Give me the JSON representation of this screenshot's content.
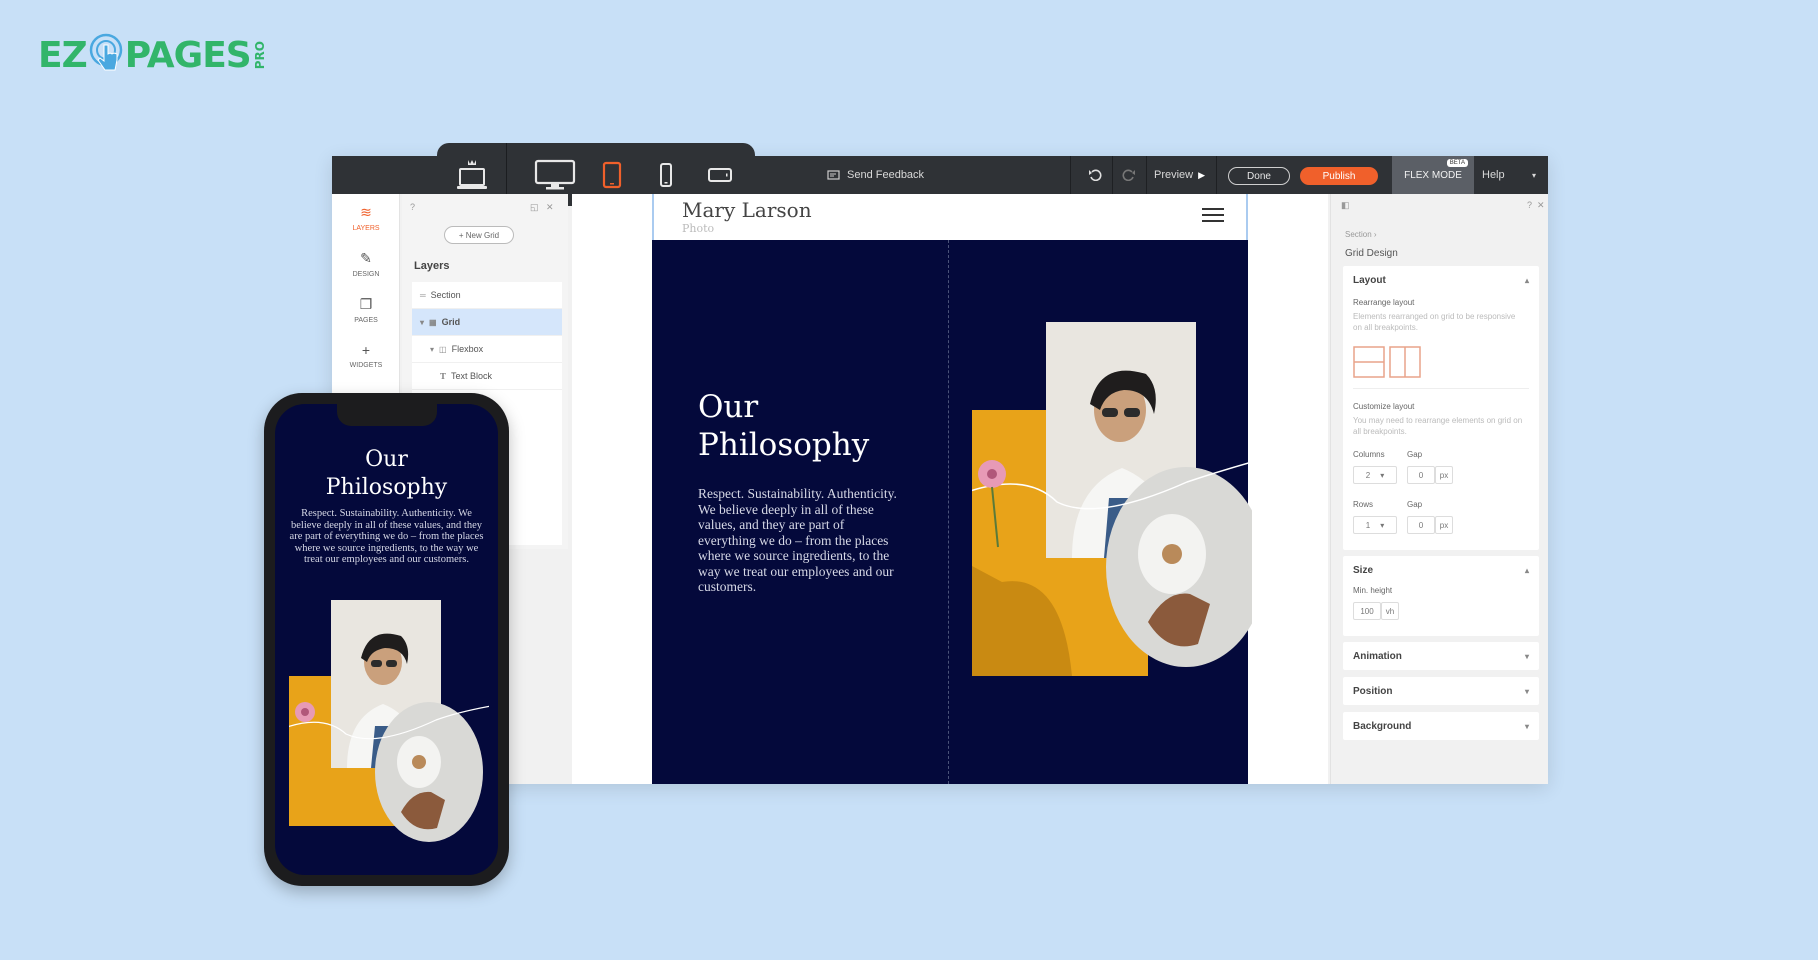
{
  "brand": {
    "ez": "EZ",
    "pages": "PAGES",
    "pro": "PRO",
    "color": "#32b56a"
  },
  "topbar": {
    "send_feedback": "Send Feedback",
    "preview": "Preview",
    "done": "Done",
    "publish": "Publish",
    "flex_mode": "FLEX MODE",
    "beta": "BETA",
    "help": "Help",
    "publish_color": "#f0602b"
  },
  "rail": {
    "items": [
      {
        "label": "LAYERS",
        "icon": "layers-icon"
      },
      {
        "label": "DESIGN",
        "icon": "brush-icon"
      },
      {
        "label": "PAGES",
        "icon": "pages-icon"
      },
      {
        "label": "WIDGETS",
        "icon": "plus-icon"
      }
    ]
  },
  "layers": {
    "new_grid": "+ New Grid",
    "title": "Layers",
    "tree": [
      {
        "label": "Section",
        "icon": "section-icon"
      },
      {
        "label": "Grid",
        "icon": "grid-icon",
        "selected": true
      },
      {
        "label": "Flexbox",
        "icon": "flexbox-icon"
      },
      {
        "label": "Text Block",
        "icon": "text-icon"
      }
    ]
  },
  "canvas": {
    "site_name": "Mary Larson",
    "site_sub": "Photo",
    "heading_line1": "Our",
    "heading_line2": "Philosophy",
    "body": "Respect. Sustainability. Authenticity. We believe deeply in all of these values, and they are part of everything we do – from the places where we source ingredients, to the way we treat our employees and our customers."
  },
  "props": {
    "crumb": "Section  ›",
    "title": "Grid Design",
    "layout": {
      "title": "Layout",
      "rearrange_label": "Rearrange layout",
      "rearrange_hint": "Elements rearranged on grid to be responsive on all breakpoints.",
      "customize_label": "Customize layout",
      "customize_hint": "You may need to rearrange elements on grid on all breakpoints.",
      "columns_label": "Columns",
      "gap_label": "Gap",
      "columns_value": "2",
      "col_gap_value": "0",
      "rows_label": "Rows",
      "rows_value": "1",
      "row_gap_value": "0",
      "unit": "px"
    },
    "size": {
      "title": "Size",
      "min_height_label": "Min. height",
      "min_height_value": "100",
      "unit": "vh"
    },
    "animation": "Animation",
    "position": "Position",
    "background": "Background"
  },
  "phone": {
    "heading_line1": "Our",
    "heading_line2": "Philosophy",
    "body": "Respect. Sustainability. Authenticity. We believe deeply in all of these values, and they are part of everything we do – from the places where we source ingredients, to the way we treat our employees and our customers."
  }
}
